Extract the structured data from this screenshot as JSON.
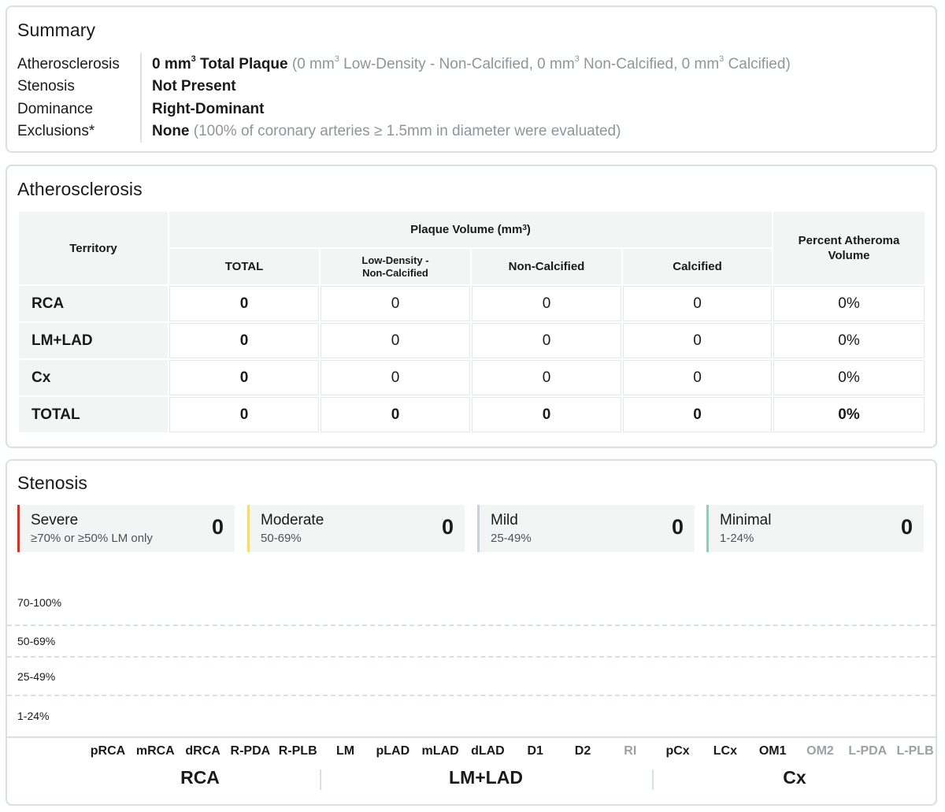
{
  "summary": {
    "title": "Summary",
    "labels": {
      "atherosclerosis": "Atherosclerosis",
      "stenosis": "Stenosis",
      "dominance": "Dominance",
      "exclusions": "Exclusions*"
    },
    "atherosclerosis": {
      "total_prefix": "0 mm",
      "sup": "3",
      "total_suffix": " Total Plaque",
      "detail_1": " (0 mm",
      "detail_2": " Low-Density - Non-Calcified, 0 mm",
      "detail_3": " Non-Calcified, 0 mm",
      "detail_4": " Calcified)"
    },
    "stenosis": "Not Present",
    "dominance": "Right-Dominant",
    "exclusions": {
      "value": "None",
      "detail": " (100% of coronary arteries ≥ 1.5mm in diameter were evaluated)"
    }
  },
  "atherosclerosis": {
    "title": "Atherosclerosis",
    "headers": {
      "territory": "Territory",
      "plaque_volume": "Plaque Volume (mm",
      "plaque_volume_sup": "3",
      "plaque_volume_end": ")",
      "total": "TOTAL",
      "low_density": "Low-Density -",
      "low_density_2": "Non-Calcified",
      "non_calcified": "Non-Calcified",
      "calcified": "Calcified",
      "pav_1": "Percent Atheroma",
      "pav_2": "Volume"
    },
    "rows": [
      {
        "territory": "RCA",
        "total": "0",
        "low_density": "0",
        "non_calcified": "0",
        "calcified": "0",
        "pav": "0%"
      },
      {
        "territory": "LM+LAD",
        "total": "0",
        "low_density": "0",
        "non_calcified": "0",
        "calcified": "0",
        "pav": "0%"
      },
      {
        "territory": "Cx",
        "total": "0",
        "low_density": "0",
        "non_calcified": "0",
        "calcified": "0",
        "pav": "0%"
      },
      {
        "territory": "TOTAL",
        "total": "0",
        "low_density": "0",
        "non_calcified": "0",
        "calcified": "0",
        "pav": "0%"
      }
    ]
  },
  "stenosis": {
    "title": "Stenosis",
    "cards": [
      {
        "title": "Severe",
        "range": "≥70% or ≥50% LM only",
        "count": "0",
        "color": "#c0392b"
      },
      {
        "title": "Moderate",
        "range": "50-69%",
        "count": "0",
        "color": "#f2dc7a"
      },
      {
        "title": "Mild",
        "range": "25-49%",
        "count": "0",
        "color": "#c9d3d5"
      },
      {
        "title": "Minimal",
        "range": "1-24%",
        "count": "0",
        "color": "#7fd6b4"
      }
    ],
    "bands": [
      "70-100%",
      "50-69%",
      "25-49%",
      "1-24%"
    ],
    "segments": [
      {
        "label": "pRCA",
        "evaluated": true
      },
      {
        "label": "mRCA",
        "evaluated": true
      },
      {
        "label": "dRCA",
        "evaluated": true
      },
      {
        "label": "R-PDA",
        "evaluated": true
      },
      {
        "label": "R-PLB",
        "evaluated": true
      },
      {
        "label": "LM",
        "evaluated": true
      },
      {
        "label": "pLAD",
        "evaluated": true
      },
      {
        "label": "mLAD",
        "evaluated": true
      },
      {
        "label": "dLAD",
        "evaluated": true
      },
      {
        "label": "D1",
        "evaluated": true
      },
      {
        "label": "D2",
        "evaluated": true
      },
      {
        "label": "RI",
        "evaluated": false
      },
      {
        "label": "pCx",
        "evaluated": true
      },
      {
        "label": "LCx",
        "evaluated": true
      },
      {
        "label": "OM1",
        "evaluated": true
      },
      {
        "label": "OM2",
        "evaluated": false
      },
      {
        "label": "L-PDA",
        "evaluated": false
      },
      {
        "label": "L-PLB",
        "evaluated": false
      }
    ],
    "groups": [
      "RCA",
      "LM+LAD",
      "Cx"
    ]
  }
}
